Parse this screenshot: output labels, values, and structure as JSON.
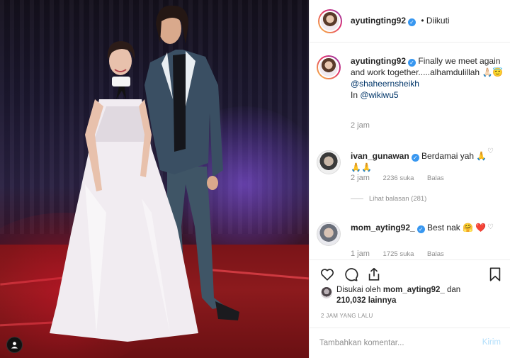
{
  "post": {
    "author": "ayutingting92",
    "follow_state": "Diikuti",
    "caption": {
      "username": "ayutingting92",
      "text_line1": "Finally we meet again and work together.....alhamdulillah 🙏🏻😇",
      "mention1": "@shaheernsheikh",
      "in_prefix": "In",
      "mention2": "@wikiwu5",
      "time": "2 jam"
    },
    "comments": [
      {
        "username": "ivan_gunawan",
        "text": "Berdamai yah 🙏🙏🙏",
        "time": "2 jam",
        "likes": "2236 suka",
        "reply_label": "Balas",
        "view_replies": "Lihat balasan (281)"
      },
      {
        "username": "mom_ayting92_",
        "text": "Best nak 🤗 ❤️",
        "time": "1 jam",
        "likes": "1725 suka",
        "reply_label": "Balas"
      }
    ],
    "likes": {
      "prefix": "Disukai oleh",
      "user": "mom_ayting92_",
      "joiner": "dan",
      "others": "210,032 lainnya"
    },
    "timestamp": "2 JAM YANG LALU",
    "add_comment": {
      "placeholder": "Tambahkan komentar...",
      "post_label": "Kirim"
    },
    "icons": [
      "heart-icon",
      "comment-icon",
      "share-icon",
      "bookmark-icon",
      "user-tag-icon",
      "verified-badge-icon"
    ],
    "colors": {
      "verified": "#3897f0",
      "mention": "#003569",
      "muted": "#8e8e8e",
      "post_button_disabled": "#b2dffc"
    }
  }
}
